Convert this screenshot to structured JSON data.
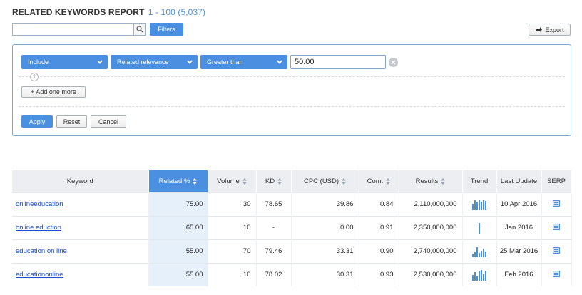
{
  "header": {
    "title": "RELATED KEYWORDS REPORT",
    "range": "1 - 100 (5,037)"
  },
  "search": {
    "value": "",
    "placeholder": ""
  },
  "toolbar": {
    "filters_label": "Filters",
    "export_label": "Export"
  },
  "filter": {
    "include_label": "Include",
    "field_label": "Related relevance",
    "operator_label": "Greater than",
    "value": "50.00",
    "add_more_label": "+ Add one more",
    "apply_label": "Apply",
    "reset_label": "Reset",
    "cancel_label": "Cancel"
  },
  "table": {
    "columns": [
      "Keyword",
      "Related %",
      "Volume",
      "KD",
      "CPC (USD)",
      "Com.",
      "Results",
      "Trend",
      "Last Update",
      "SERP"
    ],
    "rows": [
      {
        "keyword": "onlineeducation",
        "related": "75.00",
        "volume": "30",
        "kd": "78.65",
        "cpc": "39.86",
        "com": "0.84",
        "results": "2,110,000,000",
        "trend": [
          0.6,
          0.9,
          0.7,
          1.0,
          0.8,
          0.95,
          0.85
        ],
        "last_update": "10 Apr 2016"
      },
      {
        "keyword": "online eduction",
        "related": "65.00",
        "volume": "10",
        "kd": "-",
        "cpc": "0.00",
        "com": "0.91",
        "results": "2,350,000,000",
        "trend": [
          1.0
        ],
        "last_update": "Jan 2016"
      },
      {
        "keyword": "education on line",
        "related": "55.00",
        "volume": "70",
        "kd": "79.46",
        "cpc": "33.31",
        "com": "0.90",
        "results": "2,740,000,000",
        "trend": [
          0.3,
          0.5,
          0.9,
          0.4,
          0.6,
          0.8,
          0.5
        ],
        "last_update": "25 Mar 2016"
      },
      {
        "keyword": "educationonline",
        "related": "55.00",
        "volume": "10",
        "kd": "78.02",
        "cpc": "30.31",
        "com": "0.93",
        "results": "2,530,000,000",
        "trend": [
          0.5,
          0.8,
          0.4,
          0.9,
          1.0,
          0.6,
          0.9
        ],
        "last_update": "Feb 2016"
      }
    ]
  },
  "colors": {
    "accent": "#4a8fe0",
    "link": "#1a4bd1",
    "sorted_column_bg": "#e6f0fb",
    "header_bg": "#eceef1"
  },
  "icons": {
    "search": "magnifier-icon",
    "export": "export-arrow-icon",
    "dropdown": "chevron-down-icon",
    "clear": "close-circle-icon",
    "serp": "serp-page-icon",
    "sort": "sort-arrows-icon"
  }
}
